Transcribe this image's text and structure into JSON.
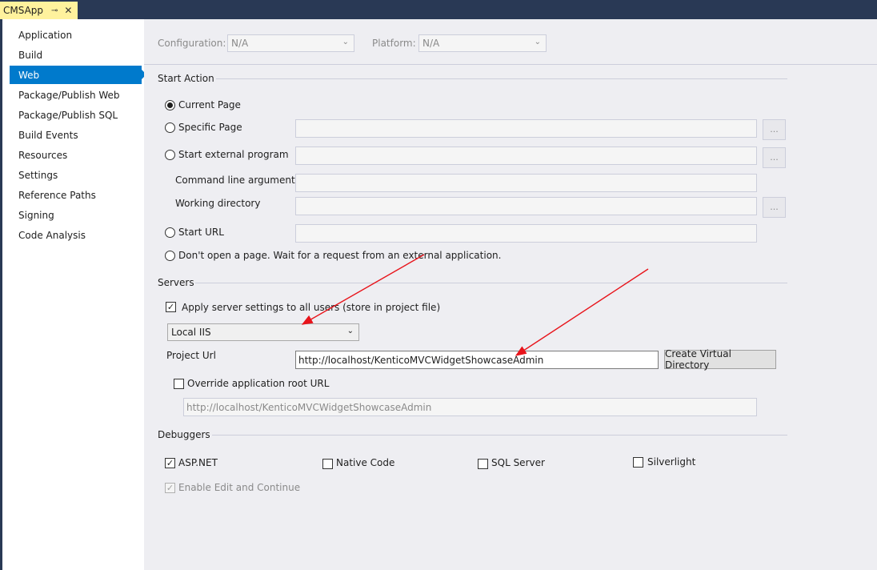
{
  "document_tab": {
    "title": "CMSApp",
    "pin_icon": "pin-icon",
    "close_icon": "close-icon"
  },
  "sidebar": {
    "items": [
      {
        "label": "Application"
      },
      {
        "label": "Build"
      },
      {
        "label": "Web",
        "active": true
      },
      {
        "label": "Package/Publish Web"
      },
      {
        "label": "Package/Publish SQL"
      },
      {
        "label": "Build Events"
      },
      {
        "label": "Resources"
      },
      {
        "label": "Settings"
      },
      {
        "label": "Reference Paths"
      },
      {
        "label": "Signing"
      },
      {
        "label": "Code Analysis"
      }
    ]
  },
  "config_bar": {
    "configuration_label": "Configuration:",
    "configuration_value": "N/A",
    "platform_label": "Platform:",
    "platform_value": "N/A"
  },
  "start_action": {
    "title": "Start Action",
    "current_page": "Current Page",
    "specific_page": "Specific Page",
    "start_external_program": "Start external program",
    "command_line_arguments": "Command line arguments",
    "working_directory": "Working directory",
    "start_url": "Start URL",
    "dont_open": "Don't open a page.  Wait for a request from an external application.",
    "browse_label": "...",
    "selected": "current_page"
  },
  "servers": {
    "title": "Servers",
    "apply_settings_label": "Apply server settings to all users (store in project file)",
    "apply_settings_checked": true,
    "server_type": "Local IIS",
    "project_url_label": "Project Url",
    "project_url_value": "http://localhost/KenticoMVCWidgetShowcaseAdmin",
    "create_virtual_directory": "Create Virtual Directory",
    "override_root_label": "Override application root URL",
    "override_root_checked": false,
    "override_root_value": "http://localhost/KenticoMVCWidgetShowcaseAdmin"
  },
  "debuggers": {
    "title": "Debuggers",
    "aspnet": "ASP.NET",
    "aspnet_checked": true,
    "native_code": "Native Code",
    "native_checked": false,
    "sql_server": "SQL Server",
    "sql_checked": false,
    "silverlight": "Silverlight",
    "silverlight_checked": false,
    "edit_continue": "Enable Edit and Continue",
    "edit_continue_checked": true
  },
  "colors": {
    "accent": "#007acc",
    "title_bar": "#293955",
    "tab": "#fff29d",
    "arrow": "#e8141b"
  }
}
